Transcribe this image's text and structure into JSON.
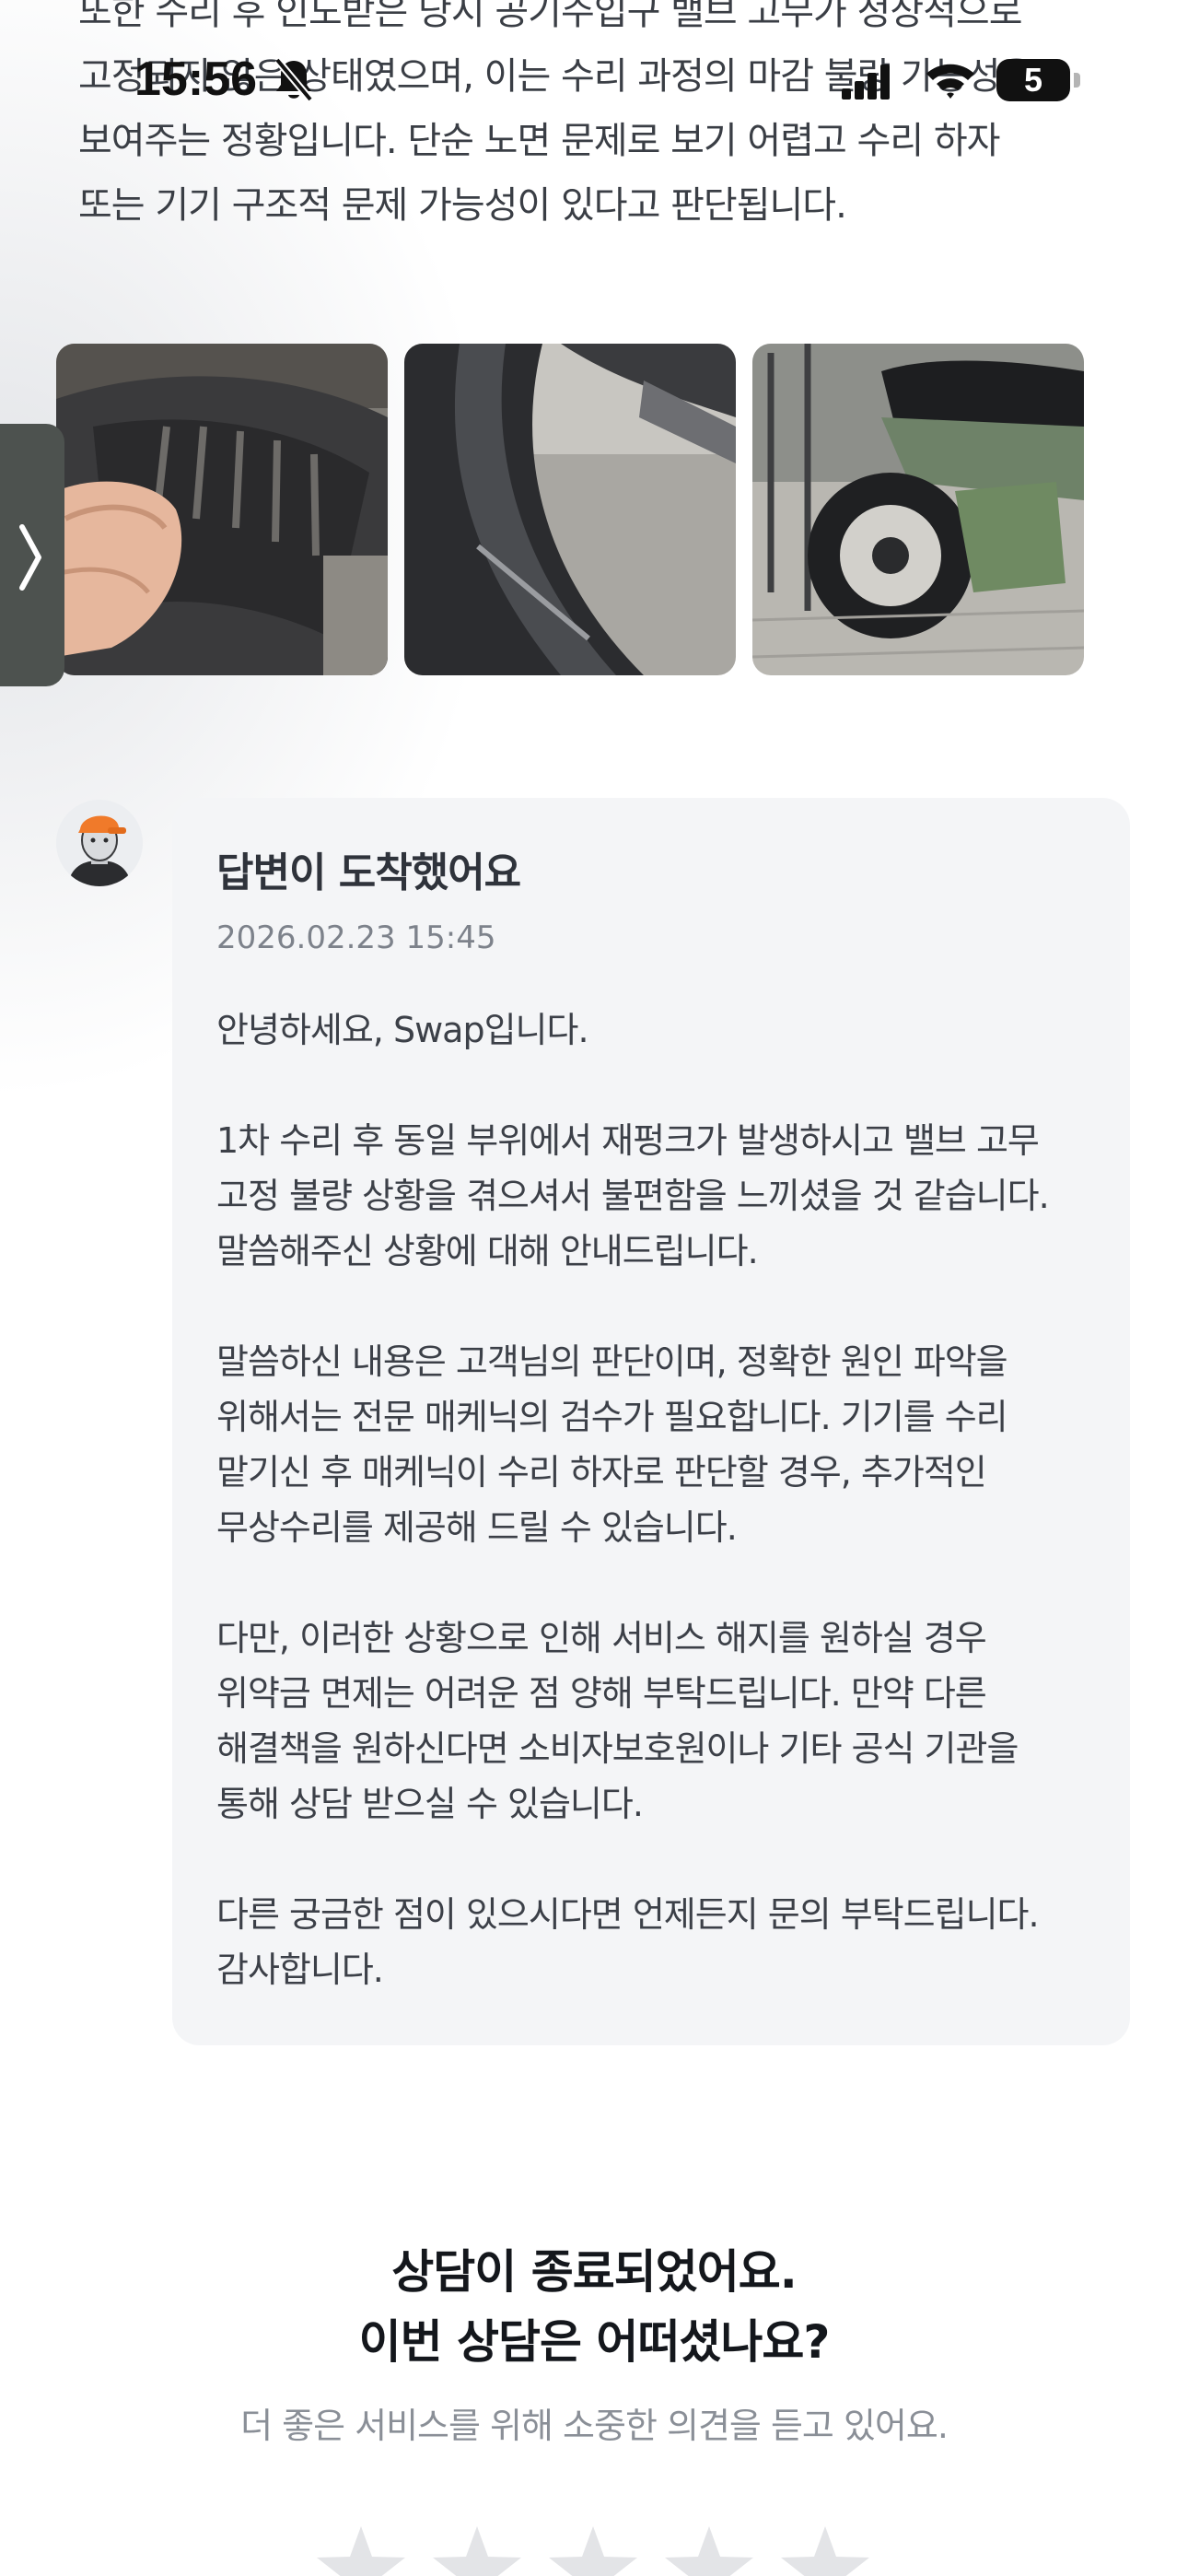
{
  "status_bar": {
    "time": "15:56",
    "battery_level": "5",
    "icons": [
      "bell-off-icon",
      "signal-icon",
      "wifi-icon",
      "battery-icon"
    ]
  },
  "user_message": {
    "lines": [
      "또한 수리 후 인도받은 당시 공기주입구 밸브 고무가 정상적으로",
      "고정되지 않은 상태였으며, 이는 수리 과정의 마감 불량 가능성을",
      "보여주는 정황입니다. 단순 노면 문제로 보기 어렵고 수리 하자",
      "또는 기기 구조적 문제 가능성이 있다고 판단됩니다."
    ]
  },
  "attachments": [
    {
      "name": "tire-closeup-photo"
    },
    {
      "name": "wheel-rim-photo"
    },
    {
      "name": "scooter-parked-photo"
    }
  ],
  "answer": {
    "title": "답변이 도착했어요",
    "date": "2026.02.23 15:45",
    "paragraphs": [
      "안녕하세요, Swap입니다.",
      "1차 수리 후 동일 부위에서 재펑크가 발생하시고 밸브 고무 고정 불량 상황을 겪으셔서 불편함을 느끼셨을 것 같습니다. 말씀해주신 상황에 대해 안내드립니다.",
      "말씀하신 내용은 고객님의 판단이며, 정확한 원인 파악을 위해서는 전문 매케닉의 검수가 필요합니다. 기기를 수리 맡기신 후 매케닉이 수리 하자로 판단할 경우, 추가적인 무상수리를 제공해 드릴 수 있습니다.",
      "다만, 이러한 상황으로 인해 서비스 해지를 원하실 경우 위약금 면제는 어려운 점 양해 부탁드립니다. 만약 다른 해결책을 원하신다면 소비자보호원이나 기타 공식 기관을 통해 상담 받으실 수 있습니다.",
      "다른 궁금한 점이 있으시다면 언제든지 문의 부탁드립니다. 감사합니다."
    ]
  },
  "rating": {
    "title_line1": "상담이 종료되었어요.",
    "title_line2": "이번 상담은 어떠셨나요?",
    "subtitle": "더 좋은 서비스를 위해 소중한 의견을 듣고 있어요.",
    "max_stars": 5,
    "selected": 0
  },
  "colors": {
    "card_bg": "#f4f5f7",
    "star_empty": "#e3e4e7",
    "avatar_accent": "#f07a2a"
  }
}
